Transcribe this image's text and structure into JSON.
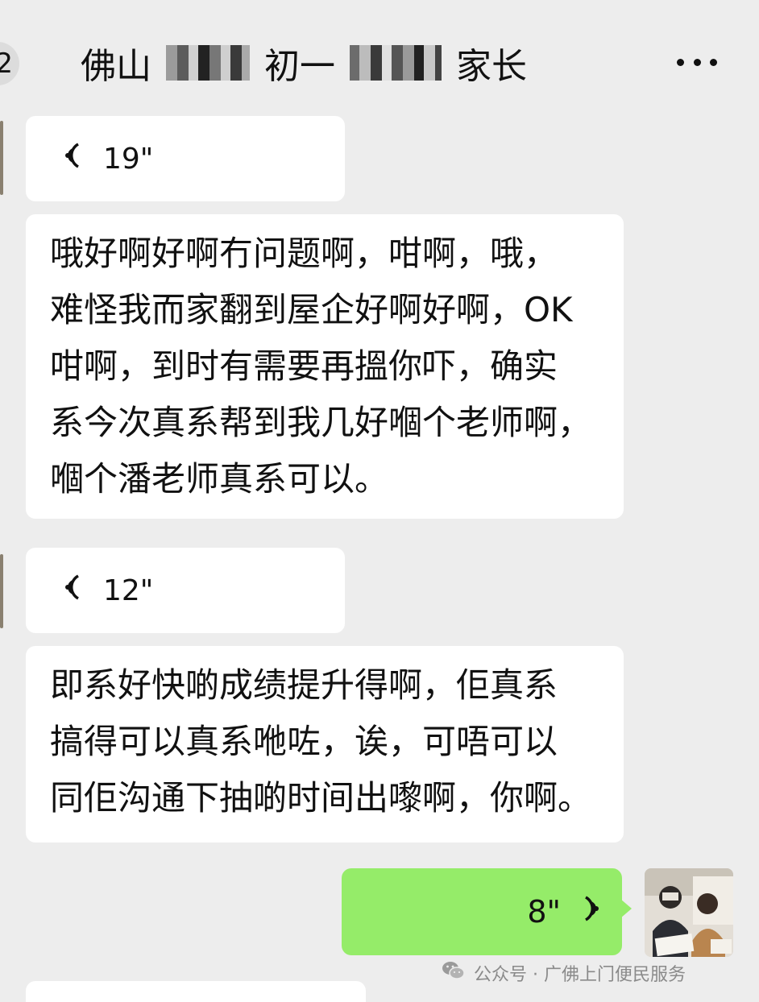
{
  "header": {
    "back_badge": "2",
    "title_part1": "佛山",
    "title_part2": "初一",
    "title_part3": "家长",
    "more_icon": "more-horizontal-icon"
  },
  "messages": [
    {
      "type": "voice_in",
      "duration": "19\"",
      "icon": "voice-wave-icon"
    },
    {
      "type": "text_in",
      "lines": [
        "哦好啊好啊冇问题啊，咁啊，哦，",
        "难怪我而家翻到屋企好啊好啊，OK",
        "咁啊，到时有需要再搵你吓，确实",
        "系今次真系帮到我几好嗰个老师啊，",
        "嗰个潘老师真系可以。"
      ]
    },
    {
      "type": "voice_in",
      "duration": "12\"",
      "icon": "voice-wave-icon"
    },
    {
      "type": "text_in",
      "lines": [
        "即系好快啲成绩提升得啊，佢真系",
        "搞得可以真系咃咗，诶，可唔可以",
        "同佢沟通下抽啲时间出嚟啊，你啊。"
      ]
    },
    {
      "type": "voice_out",
      "duration": "8\"",
      "icon": "voice-wave-icon"
    }
  ],
  "watermark": {
    "text": "公众号 · 广佛上门便民服务",
    "icon": "wechat-icon"
  },
  "colors": {
    "background": "#ededed",
    "bubble_in": "#ffffff",
    "bubble_out": "#95ec69",
    "text": "#111111"
  }
}
